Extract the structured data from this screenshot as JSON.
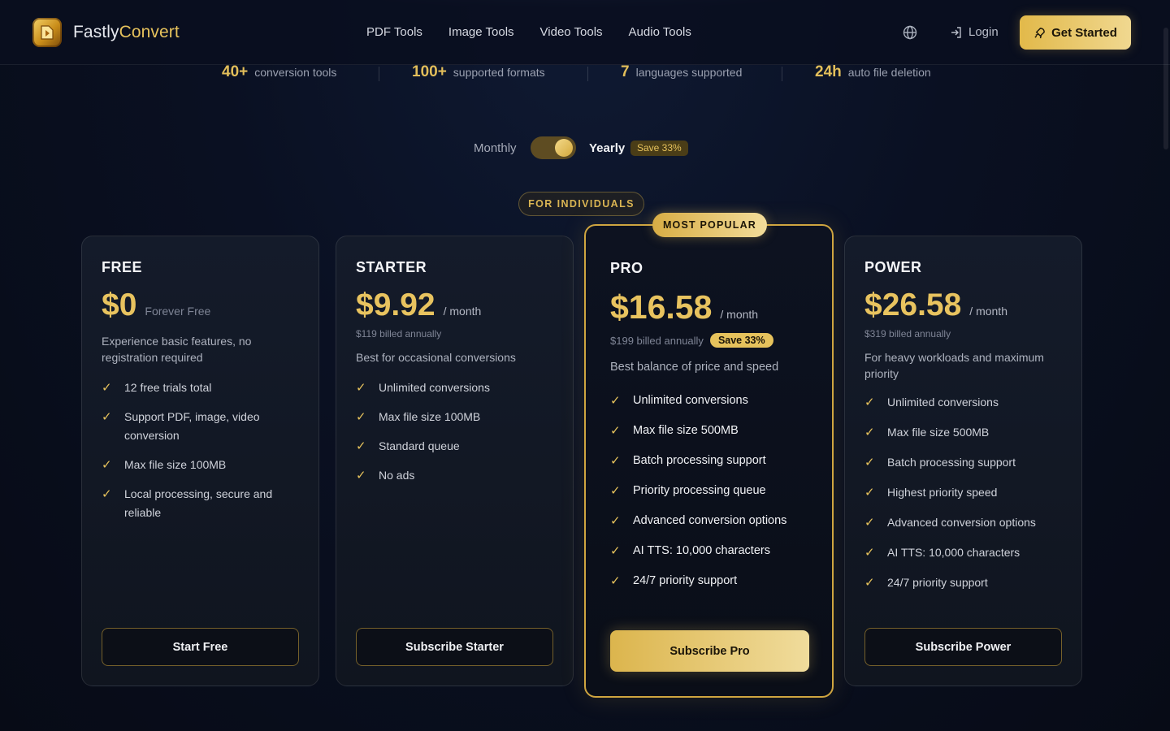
{
  "brand": {
    "name_part1": "Fastly",
    "name_part2": "Convert"
  },
  "nav": {
    "items": [
      "PDF Tools",
      "Image Tools",
      "Video Tools",
      "Audio Tools"
    ]
  },
  "header": {
    "login": "Login",
    "cta": "Get Started"
  },
  "stats": [
    {
      "num": "40+",
      "label": "conversion tools"
    },
    {
      "num": "100+",
      "label": "supported formats"
    },
    {
      "num": "7",
      "label": "languages supported"
    },
    {
      "num": "24h",
      "label": "auto file deletion"
    }
  ],
  "billing": {
    "monthly": "Monthly",
    "yearly": "Yearly",
    "save": "Save 33%",
    "selected": "Yearly"
  },
  "segment": "FOR INDIVIDUALS",
  "plans": {
    "free": {
      "name": "FREE",
      "price": "$0",
      "per": "Forever Free",
      "desc": "Experience basic features, no registration required",
      "features": [
        "12 free trials total",
        "Support PDF, image, video conversion",
        "Max file size 100MB",
        "Local processing, secure and reliable"
      ],
      "button": "Start Free"
    },
    "starter": {
      "name": "STARTER",
      "price": "$9.92",
      "per": "/ month",
      "billed": "$119 billed annually",
      "desc": "Best for occasional conversions",
      "features": [
        "Unlimited conversions",
        "Max file size 100MB",
        "Standard queue",
        "No ads"
      ],
      "button": "Subscribe Starter"
    },
    "pro": {
      "badge": "MOST POPULAR",
      "name": "PRO",
      "price": "$16.58",
      "per": "/ month",
      "billed": "$199 billed annually",
      "save": "Save 33%",
      "desc": "Best balance of price and speed",
      "features": [
        "Unlimited conversions",
        "Max file size 500MB",
        "Batch processing support",
        "Priority processing queue",
        "Advanced conversion options",
        "AI TTS: 10,000 characters",
        "24/7 priority support"
      ],
      "button": "Subscribe Pro"
    },
    "power": {
      "name": "POWER",
      "price": "$26.58",
      "per": "/ month",
      "billed": "$319 billed annually",
      "desc": "For heavy workloads and maximum priority",
      "features": [
        "Unlimited conversions",
        "Max file size 500MB",
        "Batch processing support",
        "Highest priority speed",
        "Advanced conversion options",
        "AI TTS: 10,000 characters",
        "24/7 priority support"
      ],
      "button": "Subscribe Power"
    }
  },
  "colors": {
    "accent": "#e6c25c",
    "background": "#0a1022"
  }
}
